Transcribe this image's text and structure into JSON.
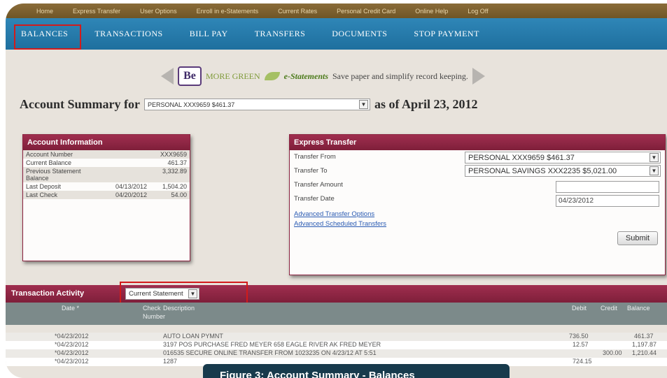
{
  "top_nav": [
    "Home",
    "Express Transfer",
    "User Options",
    "Enroll in e-Statements",
    "Current Rates",
    "Personal Credit Card",
    "Online Help",
    "Log Off"
  ],
  "main_nav": [
    "BALANCES",
    "TRANSACTIONS",
    "BILL PAY",
    "TRANSFERS",
    "DOCUMENTS",
    "STOP PAYMENT"
  ],
  "promo": {
    "more_green": "MORE GREEN",
    "estatements": "e-Statements",
    "text": "Save paper and simplify record keeping."
  },
  "summary": {
    "title": "Account Summary for",
    "account_selected": "PERSONAL XXX9659 $461.37",
    "as_of": "as of April 23, 2012"
  },
  "account_info": {
    "title": "Account Information",
    "rows": [
      {
        "label": "Account Number",
        "date": "",
        "value": "XXX9659"
      },
      {
        "label": "Current Balance",
        "date": "",
        "value": "461.37"
      },
      {
        "label": "Previous Statement Balance",
        "date": "",
        "value": "3,332.89"
      },
      {
        "label": "Last Deposit",
        "date": "04/13/2012",
        "value": "1,504.20"
      },
      {
        "label": "Last Check",
        "date": "04/20/2012",
        "value": "54.00"
      }
    ]
  },
  "express_transfer": {
    "title": "Express Transfer",
    "from_label": "Transfer From",
    "from_value": "PERSONAL XXX9659 $461.37",
    "to_label": "Transfer To",
    "to_value": "PERSONAL SAVINGS XXX2235 $5,021.00",
    "amount_label": "Transfer Amount",
    "amount_value": "",
    "date_label": "Transfer Date",
    "date_value": "04/23/2012",
    "link_advanced": "Advanced Transfer Options",
    "link_scheduled": "Advanced Scheduled Transfers",
    "submit": "Submit"
  },
  "transaction_activity": {
    "title": "Transaction Activity",
    "statement_select": "Current Statement",
    "columns": {
      "date": "Date *",
      "check": "Check",
      "check2": "Number",
      "description": "Description",
      "debit": "Debit",
      "credit": "Credit",
      "balance": "Balance"
    },
    "rows": [
      {
        "date": "*04/23/2012",
        "check": "",
        "description": "AUTO LOAN PYMNT",
        "debit": "736.50",
        "credit": "",
        "balance": "461.37"
      },
      {
        "date": "*04/23/2012",
        "check": "",
        "description": "3197 POS PURCHASE FRED MEYER 658 EAGLE RIVER AK FRED MEYER",
        "debit": "12.57",
        "credit": "",
        "balance": "1,197.87"
      },
      {
        "date": "*04/23/2012",
        "check": "",
        "description": "016535 SECURE ONLINE TRANSFER FROM 1023235 ON 4/23/12 AT 5:51",
        "debit": "",
        "credit": "300.00",
        "balance": "1,210.44"
      },
      {
        "date": "*04/23/2012",
        "check": "",
        "description": "1287",
        "debit": "724.15",
        "credit": "",
        "balance": ""
      }
    ]
  },
  "caption": "Figure 3: Account Summary - Balances"
}
